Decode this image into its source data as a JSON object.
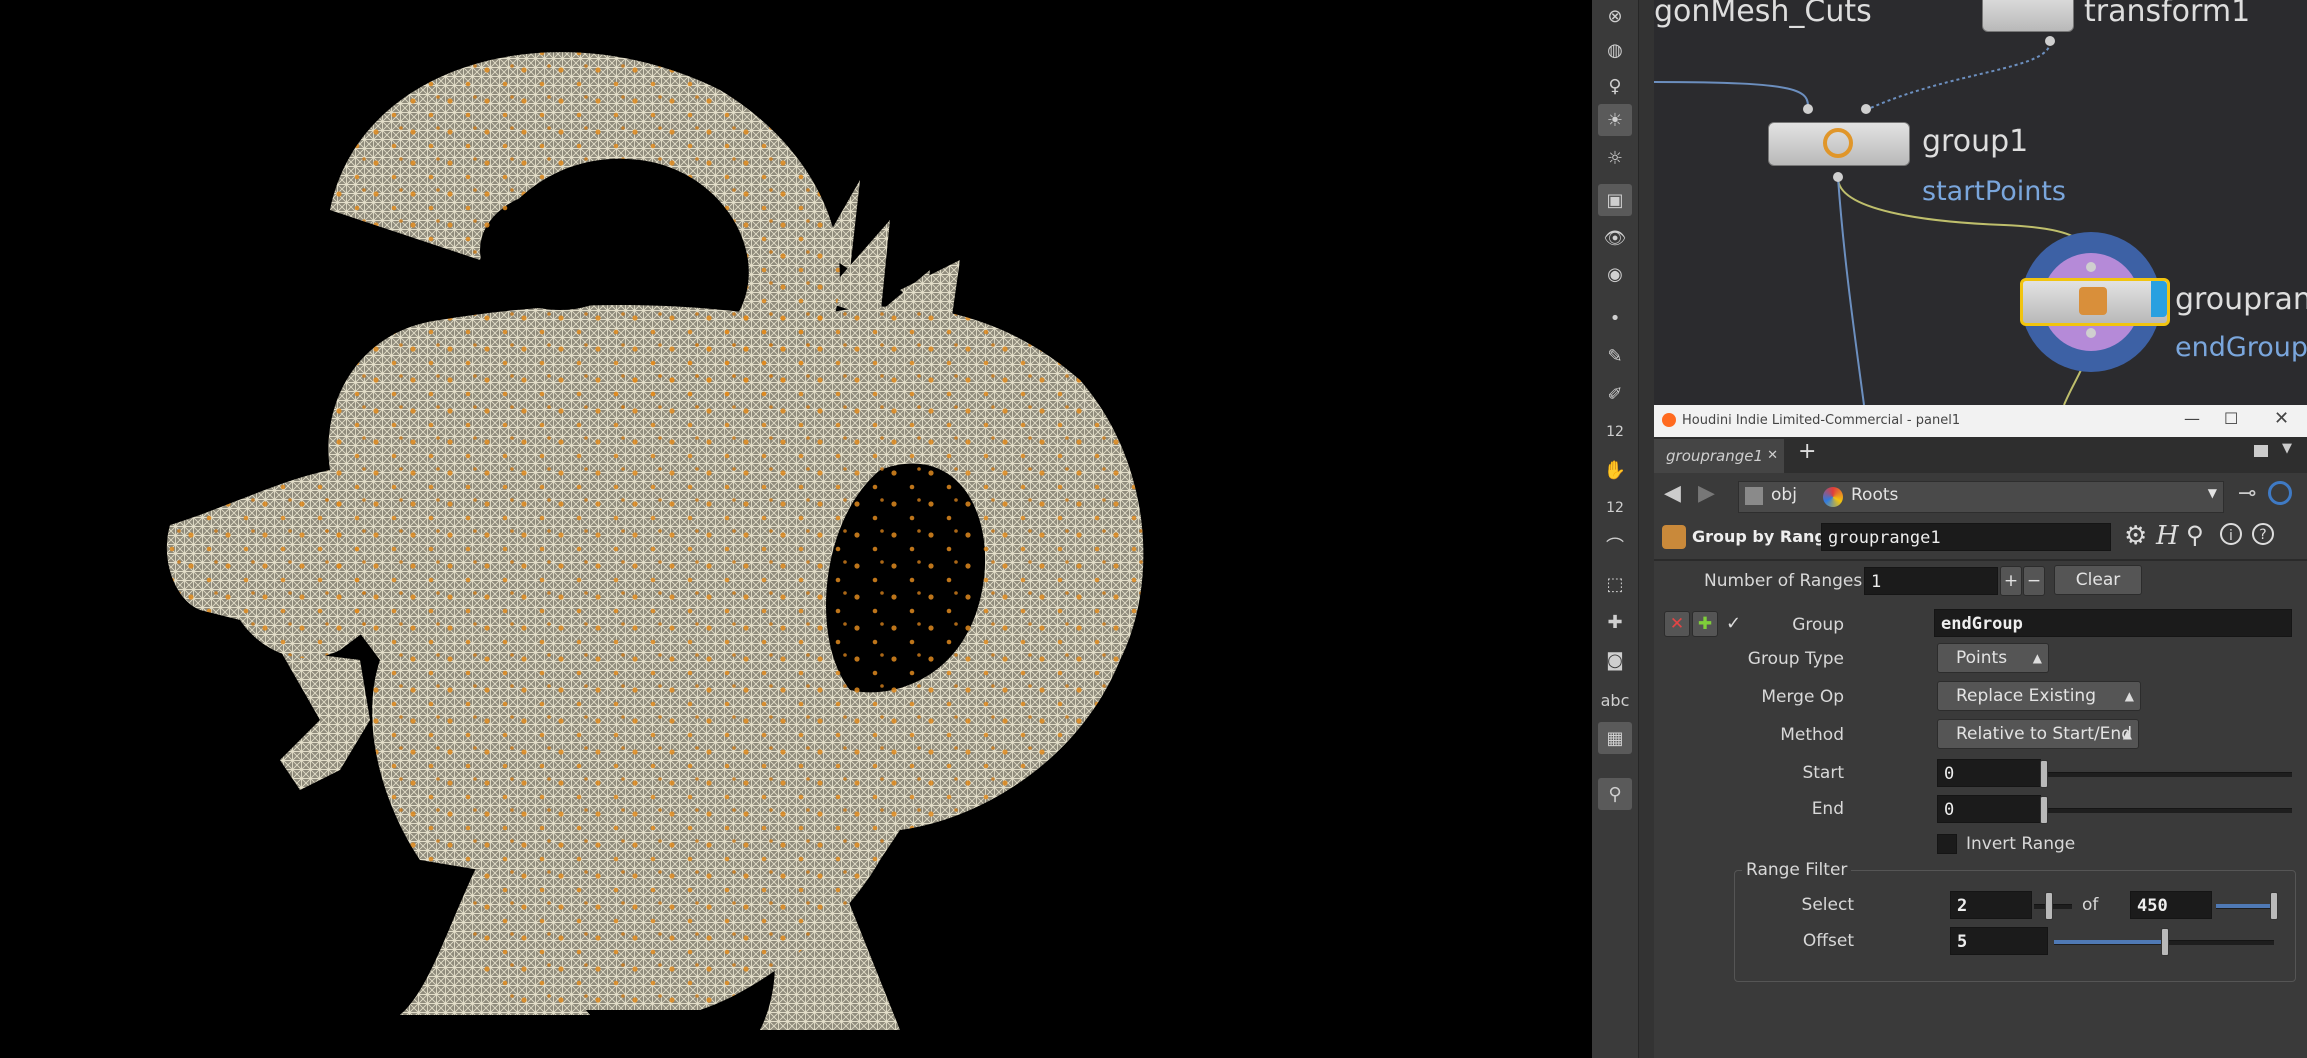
{
  "network": {
    "nodes": {
      "polymesh_label": "gonMesh_Cuts",
      "transform_label": "transform1",
      "group1_label": "group1",
      "group1_sub": "startPoints",
      "grouprange_label": "grouprang",
      "grouprange_sub": "endGroup"
    }
  },
  "shelf": {
    "icons": [
      "pin-icon",
      "light-icon",
      "spotlight-icon",
      "bulb-icon",
      "sun-icon",
      "camera-icon",
      "eye-icon",
      "eye-alt-icon",
      "point-icon",
      "brush-icon",
      "pencil-icon",
      "number-icon",
      "hand-icon",
      "sculpt-icon",
      "curve-icon",
      "snap-icon",
      "tweak-icon",
      "circle-icon",
      "text-icon",
      "image-icon",
      "marker-icon"
    ],
    "number_label": "12",
    "number_label2": "12",
    "text_label": "abc"
  },
  "window": {
    "title": "Houdini Indie Limited-Commercial - panel1",
    "tab_label": "grouprange1",
    "path_obj": "obj",
    "path_node": "Roots"
  },
  "op": {
    "type_label": "Group by Range",
    "name": "grouprange1"
  },
  "params": {
    "num_ranges_label": "Number of Ranges",
    "num_ranges_value": "1",
    "clear_label": "Clear",
    "plus_label": "+",
    "minus_label": "−",
    "group_label": "Group",
    "group_value": "endGroup",
    "group_type_label": "Group Type",
    "group_type_value": "Points",
    "merge_op_label": "Merge Op",
    "merge_op_value": "Replace Existing",
    "method_label": "Method",
    "method_value": "Relative to Start/End",
    "start_label": "Start",
    "start_value": "0",
    "end_label": "End",
    "end_value": "0",
    "invert_label": "Invert Range",
    "range_filter_label": "Range Filter",
    "select_label": "Select",
    "select_value": "2",
    "of_label": "of",
    "of_value": "450",
    "offset_label": "Offset",
    "offset_value": "5"
  },
  "colors": {
    "accent_blue": "#4f79b5",
    "node_sub_text": "#7aa6dc",
    "wireframe": "#d9d4bf",
    "points": "#e08a1e"
  }
}
